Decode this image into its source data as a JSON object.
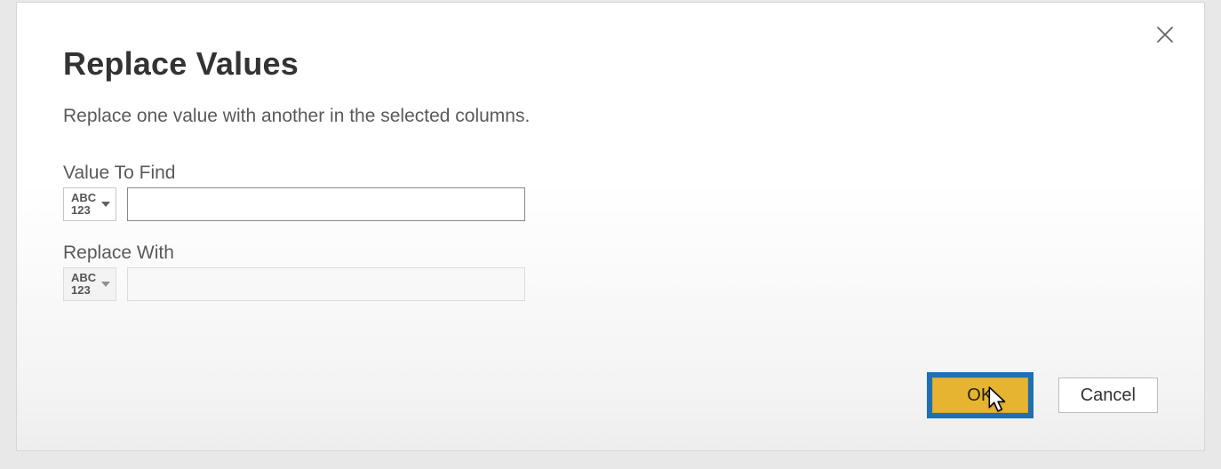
{
  "dialog": {
    "title": "Replace Values",
    "description": "Replace one value with another in the selected columns.",
    "close_label": "Close"
  },
  "fields": {
    "value_to_find": {
      "label": "Value To Find",
      "type_abc": "ABC",
      "type_123": "123",
      "value": ""
    },
    "replace_with": {
      "label": "Replace With",
      "type_abc": "ABC",
      "type_123": "123",
      "value": ""
    }
  },
  "buttons": {
    "ok": "OK",
    "cancel": "Cancel"
  }
}
